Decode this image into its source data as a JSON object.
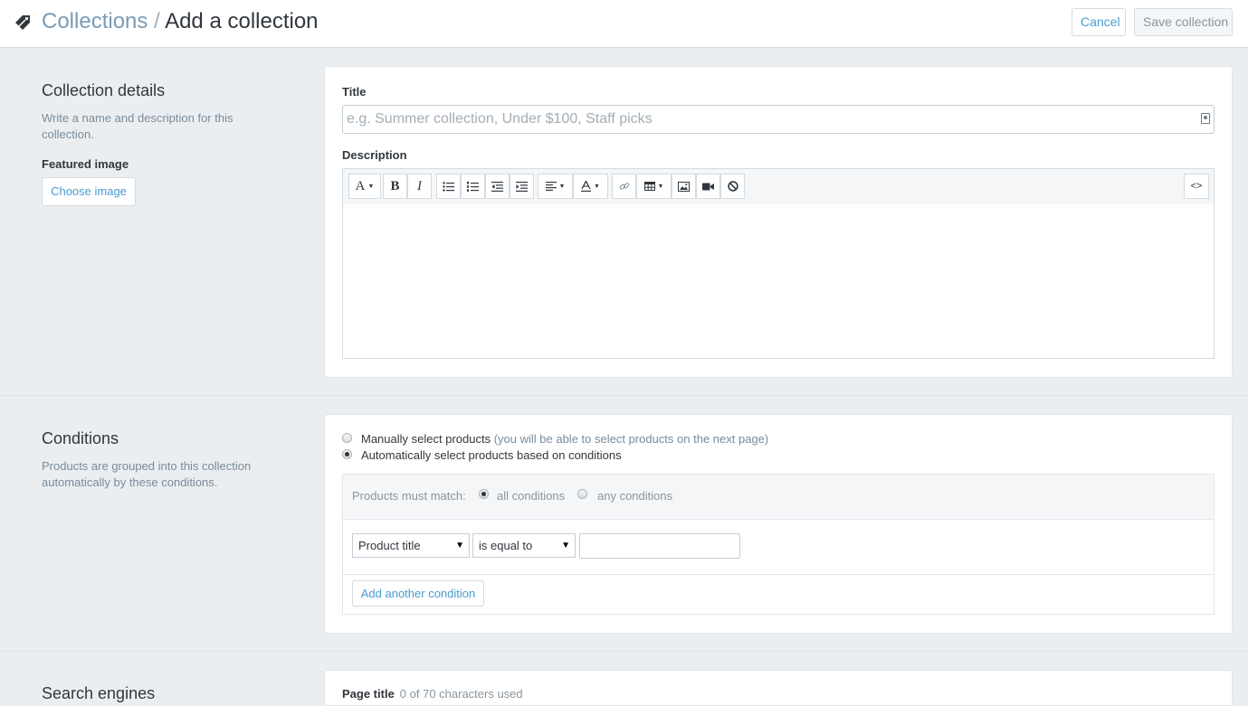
{
  "header": {
    "breadcrumb_parent": "Collections",
    "breadcrumb_separator": "/",
    "breadcrumb_current": "Add a collection",
    "cancel_label": "Cancel",
    "save_label": "Save collection"
  },
  "details": {
    "title": "Collection details",
    "description": "Write a name and description for this collection.",
    "featured_image_label": "Featured image",
    "choose_image_label": "Choose image",
    "title_field_label": "Title",
    "title_placeholder": "e.g. Summer collection, Under $100, Staff picks",
    "title_value": "",
    "description_field_label": "Description",
    "toolbar": {
      "font_label": "A",
      "bold_label": "B",
      "italic_label": "I",
      "html_label": "<>"
    }
  },
  "conditions": {
    "title": "Conditions",
    "description": "Products are grouped into this collection automatically by these conditions.",
    "manual_label": "Manually select products",
    "manual_note": "(you will be able to select products on the next page)",
    "auto_label": "Automatically select products based on conditions",
    "selected_mode": "automatic",
    "must_match_label": "Products must match:",
    "all_label": "all conditions",
    "any_label": "any conditions",
    "selected_match": "all",
    "field_select": "Product title",
    "operator_select": "is equal to",
    "value": "",
    "add_condition_label": "Add another condition"
  },
  "seo": {
    "title": "Search engines",
    "page_title_label": "Page title",
    "page_title_note": "0 of 70 characters used"
  },
  "colors": {
    "link": "#479ccf",
    "background": "#ebeef0",
    "muted_text": "#798c9c"
  }
}
